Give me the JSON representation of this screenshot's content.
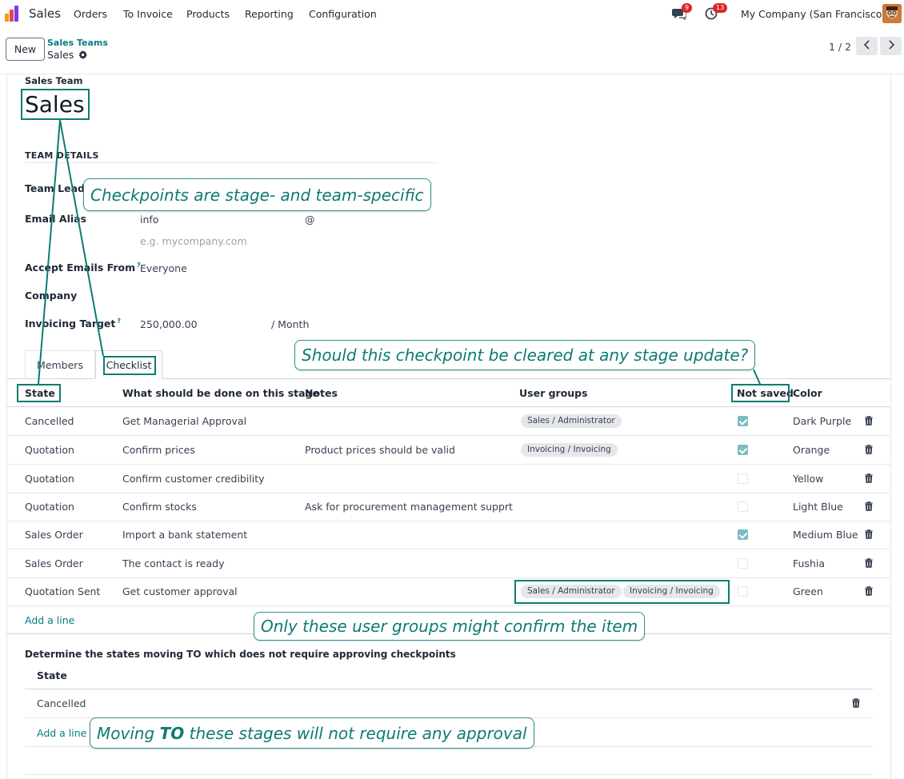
{
  "navbar": {
    "app_name": "Sales",
    "menu": [
      "Orders",
      "To Invoice",
      "Products",
      "Reporting",
      "Configuration"
    ],
    "chat_badge": "9",
    "activity_badge": "13",
    "company": "My Company (San Francisco)"
  },
  "control": {
    "new_label": "New",
    "breadcrumb_parent": "Sales Teams",
    "breadcrumb_current": "Sales",
    "pager": "1 / 2"
  },
  "form": {
    "title_label": "Sales Team",
    "title": "Sales",
    "section": "TEAM DETAILS",
    "team_leader_label": "Team Leader",
    "email_alias_label": "Email Alias",
    "email_alias_value": "info",
    "email_at": "@",
    "email_domain_placeholder": "e.g. mycompany.com",
    "accept_from_label": "Accept Emails From",
    "accept_from_value": "Everyone",
    "company_label": "Company",
    "invoicing_target_label": "Invoicing Target",
    "invoicing_target_value": "250,000.00",
    "invoicing_target_unit": "/ Month",
    "help_mark": "?"
  },
  "tabs": {
    "members": "Members",
    "checklist": "Checklist"
  },
  "checklist": {
    "headers": {
      "state": "State",
      "what": "What should be done on this stage",
      "notes": "Notes",
      "groups": "User groups",
      "not_saved": "Not saved",
      "color": "Color"
    },
    "rows": [
      {
        "state": "Cancelled",
        "what": "Get Managerial Approval",
        "notes": "",
        "groups": [
          "Sales / Administrator"
        ],
        "not_saved": true,
        "color": "Dark Purple"
      },
      {
        "state": "Quotation",
        "what": "Confirm prices",
        "notes": "Product prices should be valid",
        "groups": [
          "Invoicing / Invoicing"
        ],
        "not_saved": true,
        "color": "Orange"
      },
      {
        "state": "Quotation",
        "what": "Confirm customer credibility",
        "notes": "",
        "groups": [],
        "not_saved": false,
        "color": "Yellow"
      },
      {
        "state": "Quotation",
        "what": "Confirm stocks",
        "notes": "Ask for procurement management supprt",
        "groups": [],
        "not_saved": false,
        "color": "Light Blue"
      },
      {
        "state": "Sales Order",
        "what": "Import a bank statement",
        "notes": "",
        "groups": [],
        "not_saved": true,
        "color": "Medium Blue"
      },
      {
        "state": "Sales Order",
        "what": "The contact is ready",
        "notes": "",
        "groups": [],
        "not_saved": false,
        "color": "Fushia"
      },
      {
        "state": "Quotation Sent",
        "what": "Get customer approval",
        "notes": "",
        "groups": [
          "Sales / Administrator",
          "Invoicing / Invoicing"
        ],
        "not_saved": false,
        "color": "Green"
      }
    ],
    "add_line": "Add a line"
  },
  "no_approval": {
    "label": "Determine the states moving TO which does not require approving checkpoints",
    "header": "State",
    "rows": [
      "Cancelled"
    ],
    "add_line": "Add a line"
  },
  "callouts": {
    "c1": "Checkpoints are stage- and team-specific",
    "c2": "Should this checkpoint be cleared at any stage update?",
    "c3": "Only these user groups might confirm the item",
    "c4_pre": "Moving ",
    "c4_bold": "TO",
    "c4_post": " these stages will not require any approval"
  },
  "colors": {
    "accent": "#017e84",
    "annotation": "#0e7b73",
    "badge": "#dc2626"
  }
}
